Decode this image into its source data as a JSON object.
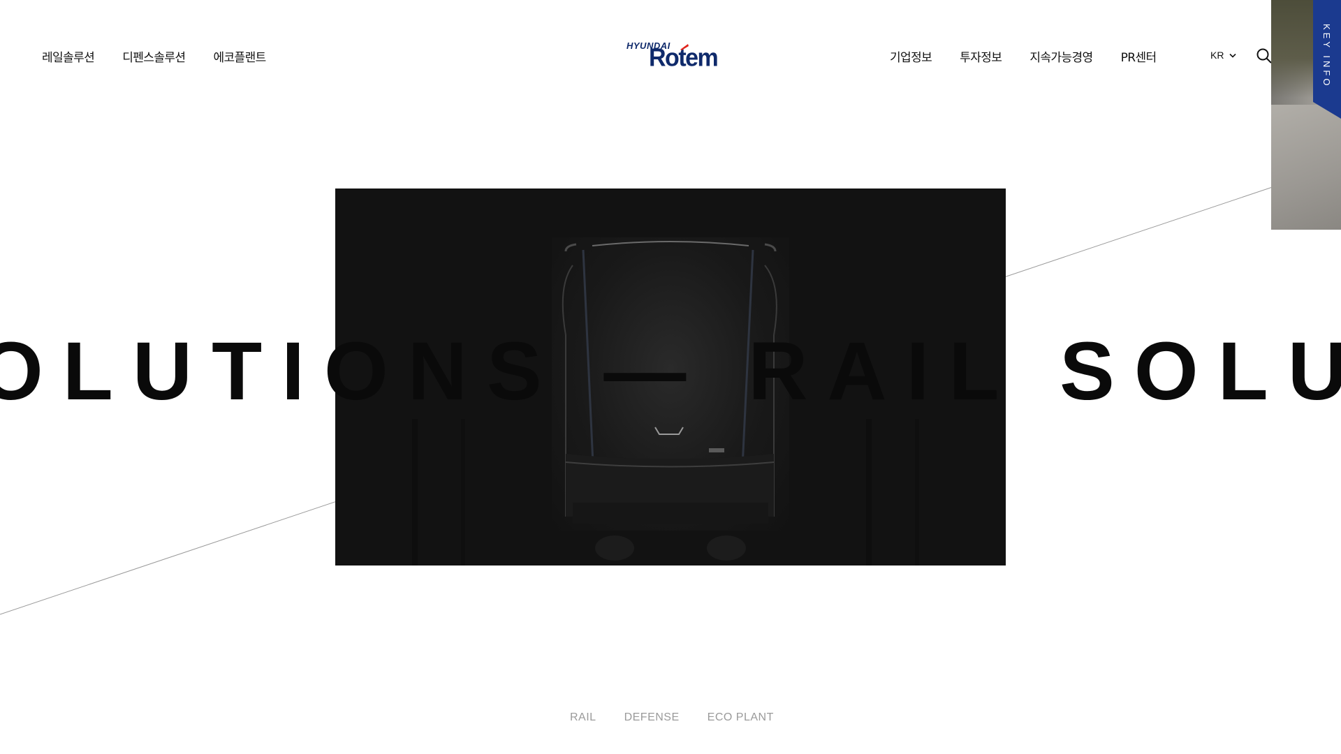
{
  "header": {
    "nav_left": [
      {
        "label": "레일솔루션"
      },
      {
        "label": "디펜스솔루션"
      },
      {
        "label": "에코플랜트"
      }
    ],
    "nav_right": [
      {
        "label": "기업정보"
      },
      {
        "label": "투자정보"
      },
      {
        "label": "지속가능경영"
      },
      {
        "label": "PR센터"
      }
    ],
    "logo": {
      "top": "HYUNDAI",
      "main": "Rotem"
    },
    "language": {
      "selected": "KR",
      "icon": "chevron-down-icon"
    },
    "search": {
      "icon": "search-icon"
    }
  },
  "key_info": {
    "label": "KEY INFO",
    "color": "#1b3a8f"
  },
  "hero": {
    "marquee_text": "OLUTIONS — RAIL SOLUTI",
    "video_background": "#121212"
  },
  "categories": [
    {
      "label": "RAIL"
    },
    {
      "label": "DEFENSE"
    },
    {
      "label": "ECO PLANT"
    }
  ],
  "colors": {
    "brand_navy": "#0f2a6b",
    "brand_red": "#e2231a",
    "tab_blue": "#1b3a8f",
    "muted_text": "#9a9a9a"
  }
}
